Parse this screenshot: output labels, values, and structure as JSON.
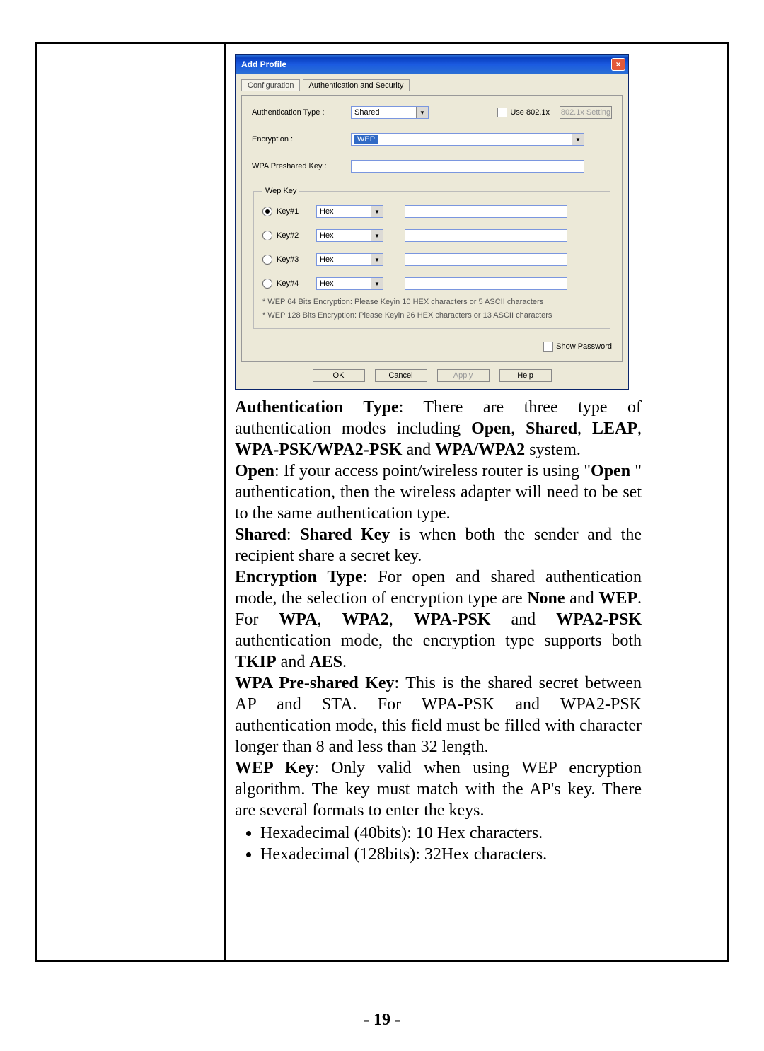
{
  "dialog": {
    "title": "Add Profile",
    "close": "×",
    "tabs": {
      "config": "Configuration",
      "auth": "Authentication and Security"
    },
    "rows": {
      "authTypeLabel": "Authentication Type :",
      "authTypeValue": "Shared",
      "use8021x": "Use 802.1x",
      "btn8021x": "802.1x Setting",
      "encryptionLabel": "Encryption :",
      "encryptionValue": "WEP",
      "wpaPskLabel": "WPA Preshared Key :",
      "wpaPskValue": ""
    },
    "wep": {
      "legend": "Wep Key",
      "keys": [
        {
          "label": "Key#1",
          "fmt": "Hex",
          "checked": true,
          "val": ""
        },
        {
          "label": "Key#2",
          "fmt": "Hex",
          "checked": false,
          "val": ""
        },
        {
          "label": "Key#3",
          "fmt": "Hex",
          "checked": false,
          "val": ""
        },
        {
          "label": "Key#4",
          "fmt": "Hex",
          "checked": false,
          "val": ""
        }
      ],
      "note1": "* WEP 64 Bits Encryption:  Please Keyin 10 HEX characters or 5 ASCII characters",
      "note2": "* WEP 128 Bits Encryption:  Please Keyin 26 HEX characters or 13 ASCII characters"
    },
    "showPassword": "Show Password",
    "buttons": {
      "ok": "OK",
      "cancel": "Cancel",
      "apply": "Apply",
      "help": "Help"
    }
  },
  "text": {
    "authType_b1": "Authentication Type",
    "authType_t1": ": There are three type of authentication modes including ",
    "authType_b2": "Open",
    "authType_t2": ", ",
    "authType_b3": "Shared",
    "authType_t3": ", ",
    "authType_b4": "LEAP",
    "authType_t4": ", ",
    "authType_b5": "WPA-PSK/WPA2-PSK",
    "authType_t5": " and ",
    "authType_b6": "WPA/WPA2",
    "authType_t6": " system.",
    "open_b1": "Open",
    "open_t1": ": If your access point/wireless router is using \"",
    "open_b2": "Open",
    "open_t2": " \" authentication, then the wireless adapter will need to be set to the same authentication type.",
    "shared_b1": "Shared",
    "shared_t1": ": ",
    "shared_b2": "Shared Key",
    "shared_t2": " is when both the sender and the recipient share a secret key.",
    "enc_b1": "Encryption Type",
    "enc_t1": ": For open and shared authentication mode, the selection of encryption type are ",
    "enc_b2": "None",
    "enc_t2": " and ",
    "enc_b3": "WEP",
    "enc_t3": ". For ",
    "enc_b4": "WPA",
    "enc_t4": ", ",
    "enc_b5": "WPA2",
    "enc_t5": ", ",
    "enc_b6": "WPA-PSK",
    "enc_t6": " and ",
    "enc_b7": "WPA2-PSK",
    "enc_t7": " authentication mode, the encryption type supports both ",
    "enc_b8": "TKIP",
    "enc_t8": " and ",
    "enc_b9": "AES",
    "enc_t9": ".",
    "wpa_b1": "WPA Pre-shared Key",
    "wpa_t1": ": This is the shared secret between AP and STA. For WPA-PSK and WPA2-PSK authentication mode, this field must be filled with character longer than 8 and less than 32 length.",
    "wep_b1": "WEP Key",
    "wep_t1": ": Only valid when using WEP encryption algorithm. The key must match with the AP's key. There are several formats to enter the keys.",
    "bullet1": "Hexadecimal (40bits): 10 Hex characters.",
    "bullet2": "Hexadecimal (128bits): 32Hex characters."
  },
  "pagenum": "- 19 -"
}
